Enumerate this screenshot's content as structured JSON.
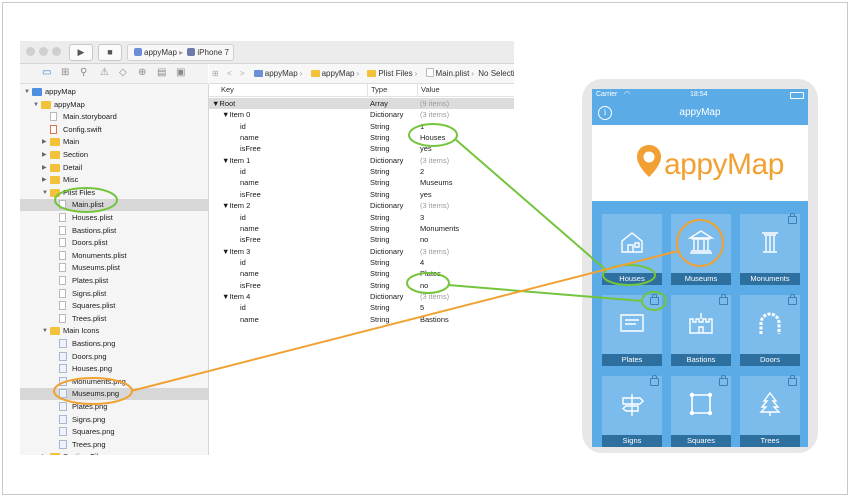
{
  "toolbar": {
    "run_icon": "▶",
    "stop_icon": "■",
    "scheme": "appyMap",
    "device": "iPhone 7"
  },
  "jumpbar": {
    "back": "<",
    "forward": ">",
    "crumbs": [
      "appyMap",
      "appyMap",
      "Plist Files",
      "Main.plist"
    ],
    "selection": "No Selection"
  },
  "navigator": {
    "items": [
      {
        "label": "appyMap",
        "depth": 0,
        "kind": "project",
        "tri": "▼"
      },
      {
        "label": "appyMap",
        "depth": 1,
        "kind": "folder",
        "tri": "▼"
      },
      {
        "label": "Main.storyboard",
        "depth": 2,
        "kind": "doc",
        "tri": ""
      },
      {
        "label": "Config.swift",
        "depth": 2,
        "kind": "swift",
        "tri": ""
      },
      {
        "label": "Main",
        "depth": 2,
        "kind": "folder",
        "tri": "▶"
      },
      {
        "label": "Section",
        "depth": 2,
        "kind": "folder",
        "tri": "▶"
      },
      {
        "label": "Detail",
        "depth": 2,
        "kind": "folder",
        "tri": "▶"
      },
      {
        "label": "Misc",
        "depth": 2,
        "kind": "folder",
        "tri": "▶"
      },
      {
        "label": "Plist Files",
        "depth": 2,
        "kind": "folder",
        "tri": "▼"
      },
      {
        "label": "Main.plist",
        "depth": 3,
        "kind": "doc",
        "tri": "",
        "selected": true
      },
      {
        "label": "Houses.plist",
        "depth": 3,
        "kind": "doc",
        "tri": ""
      },
      {
        "label": "Bastions.plist",
        "depth": 3,
        "kind": "doc",
        "tri": ""
      },
      {
        "label": "Doors.plist",
        "depth": 3,
        "kind": "doc",
        "tri": ""
      },
      {
        "label": "Monuments.plist",
        "depth": 3,
        "kind": "doc",
        "tri": ""
      },
      {
        "label": "Museums.plist",
        "depth": 3,
        "kind": "doc",
        "tri": ""
      },
      {
        "label": "Plates.plist",
        "depth": 3,
        "kind": "doc",
        "tri": ""
      },
      {
        "label": "Signs.plist",
        "depth": 3,
        "kind": "doc",
        "tri": ""
      },
      {
        "label": "Squares.plist",
        "depth": 3,
        "kind": "doc",
        "tri": ""
      },
      {
        "label": "Trees.plist",
        "depth": 3,
        "kind": "doc",
        "tri": ""
      },
      {
        "label": "Main Icons",
        "depth": 2,
        "kind": "folder",
        "tri": "▼"
      },
      {
        "label": "Bastions.png",
        "depth": 3,
        "kind": "img",
        "tri": ""
      },
      {
        "label": "Doors.png",
        "depth": 3,
        "kind": "img",
        "tri": ""
      },
      {
        "label": "Houses.png",
        "depth": 3,
        "kind": "img",
        "tri": ""
      },
      {
        "label": "Monuments.png",
        "depth": 3,
        "kind": "img",
        "tri": ""
      },
      {
        "label": "Museums.png",
        "depth": 3,
        "kind": "img",
        "tri": "",
        "selected": true
      },
      {
        "label": "Plates.png",
        "depth": 3,
        "kind": "img",
        "tri": ""
      },
      {
        "label": "Signs.png",
        "depth": 3,
        "kind": "img",
        "tri": ""
      },
      {
        "label": "Squares.png",
        "depth": 3,
        "kind": "img",
        "tri": ""
      },
      {
        "label": "Trees.png",
        "depth": 3,
        "kind": "img",
        "tri": ""
      },
      {
        "label": "Section Files",
        "depth": 2,
        "kind": "folder",
        "tri": "▶"
      }
    ]
  },
  "plist": {
    "headers": {
      "key": "Key",
      "type": "Type",
      "value": "Value"
    },
    "rows": [
      {
        "key": "▼Root",
        "type": "Array",
        "value": "(9 items)",
        "indent": 0,
        "gray": true,
        "root": true
      },
      {
        "key": "▼Item 0",
        "type": "Dictionary",
        "value": "(3 items)",
        "indent": 1,
        "gray": true
      },
      {
        "key": "id",
        "type": "String",
        "value": "1",
        "indent": 2
      },
      {
        "key": "name",
        "type": "String",
        "value": "Houses",
        "indent": 2
      },
      {
        "key": "isFree",
        "type": "String",
        "value": "yes",
        "indent": 2
      },
      {
        "key": "▼Item 1",
        "type": "Dictionary",
        "value": "(3 items)",
        "indent": 1,
        "gray": true
      },
      {
        "key": "id",
        "type": "String",
        "value": "2",
        "indent": 2
      },
      {
        "key": "name",
        "type": "String",
        "value": "Museums",
        "indent": 2
      },
      {
        "key": "isFree",
        "type": "String",
        "value": "yes",
        "indent": 2
      },
      {
        "key": "▼Item 2",
        "type": "Dictionary",
        "value": "(3 items)",
        "indent": 1,
        "gray": true
      },
      {
        "key": "id",
        "type": "String",
        "value": "3",
        "indent": 2
      },
      {
        "key": "name",
        "type": "String",
        "value": "Monuments",
        "indent": 2
      },
      {
        "key": "isFree",
        "type": "String",
        "value": "no",
        "indent": 2
      },
      {
        "key": "▼Item 3",
        "type": "Dictionary",
        "value": "(3 items)",
        "indent": 1,
        "gray": true
      },
      {
        "key": "id",
        "type": "String",
        "value": "4",
        "indent": 2
      },
      {
        "key": "name",
        "type": "String",
        "value": "Plates",
        "indent": 2
      },
      {
        "key": "isFree",
        "type": "String",
        "value": "no",
        "indent": 2
      },
      {
        "key": "▼Item 4",
        "type": "Dictionary",
        "value": "(3 items)",
        "indent": 1,
        "gray": true
      },
      {
        "key": "id",
        "type": "String",
        "value": "5",
        "indent": 2
      },
      {
        "key": "name",
        "type": "String",
        "value": "Bastions",
        "indent": 2
      }
    ]
  },
  "phone": {
    "carrier": "Carrier",
    "time": "18:54",
    "title": "appyMap",
    "logo_text": "appyMap",
    "tiles": [
      {
        "label": "Houses",
        "icon": "house-icon",
        "locked": false
      },
      {
        "label": "Museums",
        "icon": "museum-icon",
        "locked": false
      },
      {
        "label": "Monuments",
        "icon": "column-icon",
        "locked": true
      },
      {
        "label": "Plates",
        "icon": "plate-icon",
        "locked": true
      },
      {
        "label": "Bastions",
        "icon": "castle-icon",
        "locked": true
      },
      {
        "label": "Doors",
        "icon": "door-arch-icon",
        "locked": true
      },
      {
        "label": "Signs",
        "icon": "signpost-icon",
        "locked": true
      },
      {
        "label": "Squares",
        "icon": "square-icon",
        "locked": true
      },
      {
        "label": "Trees",
        "icon": "tree-icon",
        "locked": true
      }
    ]
  },
  "colors": {
    "annotation_green": "#74c43c",
    "annotation_orange": "#f0a132",
    "app_blue": "#5aabe6",
    "tile_blue": "#7cbcec",
    "caption_blue": "#2d6f9f"
  }
}
